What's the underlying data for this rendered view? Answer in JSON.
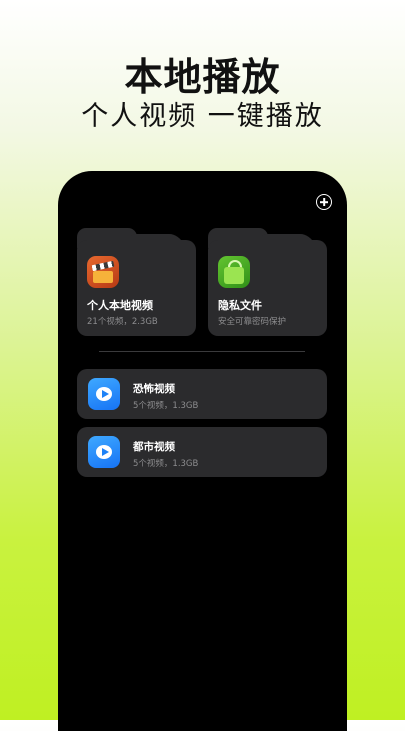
{
  "header": {
    "title": "本地播放",
    "subtitle": "个人视频 一键播放"
  },
  "toolbar": {
    "add_icon": "plus-circle-icon"
  },
  "folders": [
    {
      "title": "个人本地视频",
      "subtitle": "21个视频，2.3GB",
      "icon": "film-clapper-icon"
    },
    {
      "title": "隐私文件",
      "subtitle": "安全可靠密码保护",
      "icon": "shopping-bag-icon"
    }
  ],
  "list": [
    {
      "title": "恐怖视频",
      "subtitle": "5个视频，1.3GB",
      "icon": "play-video-icon"
    },
    {
      "title": "都市视频",
      "subtitle": "5个视频，1.3GB",
      "icon": "play-video-icon"
    }
  ],
  "colors": {
    "background_top": "#ffffff",
    "background_bottom": "#bff022",
    "phone_background": "#000000",
    "card_background": "#2b2b2d",
    "accent_blue": "#1d82f7"
  }
}
